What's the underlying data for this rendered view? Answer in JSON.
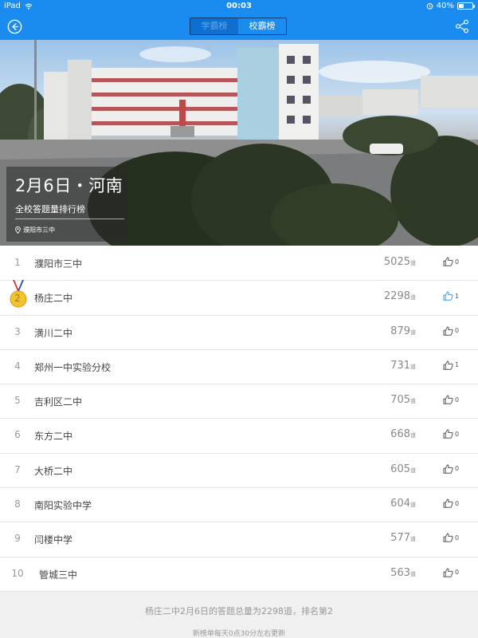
{
  "status_bar": {
    "device": "iPad",
    "time": "00:03",
    "battery": "40%",
    "battery_level": 0.4
  },
  "nav": {
    "tabs": [
      {
        "label": "学霸榜",
        "active": false
      },
      {
        "label": "校霸榜",
        "active": true
      }
    ]
  },
  "hero": {
    "title": "2月6日・河南",
    "subtitle": "全校答题量排行榜",
    "location": "濮阳市三中"
  },
  "ranking": [
    {
      "rank": "1",
      "name": "濮阳市三中",
      "count": "5025",
      "unit": "道",
      "likes": "0",
      "liked": false
    },
    {
      "rank": "2",
      "name": "杨庄二中",
      "count": "2298",
      "unit": "道",
      "likes": "1",
      "liked": true
    },
    {
      "rank": "3",
      "name": "潢川二中",
      "count": "879",
      "unit": "道",
      "likes": "0",
      "liked": false
    },
    {
      "rank": "4",
      "name": "郑州一中实验分校",
      "count": "731",
      "unit": "道",
      "likes": "1",
      "liked": false
    },
    {
      "rank": "5",
      "name": "吉利区二中",
      "count": "705",
      "unit": "道",
      "likes": "0",
      "liked": false
    },
    {
      "rank": "6",
      "name": "东方二中",
      "count": "668",
      "unit": "道",
      "likes": "0",
      "liked": false
    },
    {
      "rank": "7",
      "name": "大桥二中",
      "count": "605",
      "unit": "道",
      "likes": "0",
      "liked": false
    },
    {
      "rank": "8",
      "name": "南阳实验中学",
      "count": "604",
      "unit": "道",
      "likes": "0",
      "liked": false
    },
    {
      "rank": "9",
      "name": "闫楼中学",
      "count": "577",
      "unit": "道",
      "likes": "0",
      "liked": false
    },
    {
      "rank": "10",
      "name": "管城三中",
      "count": "563",
      "unit": "道",
      "likes": "0",
      "liked": false
    }
  ],
  "footer": {
    "summary": "杨庄二中2月6日的答题总量为2298道，排名第2",
    "note": "新榜单每天0点30分左右更新"
  },
  "colors": {
    "header_blue": "#1a8cf0",
    "like_active": "#3a9be6",
    "medal_gold": "#f2c230"
  }
}
